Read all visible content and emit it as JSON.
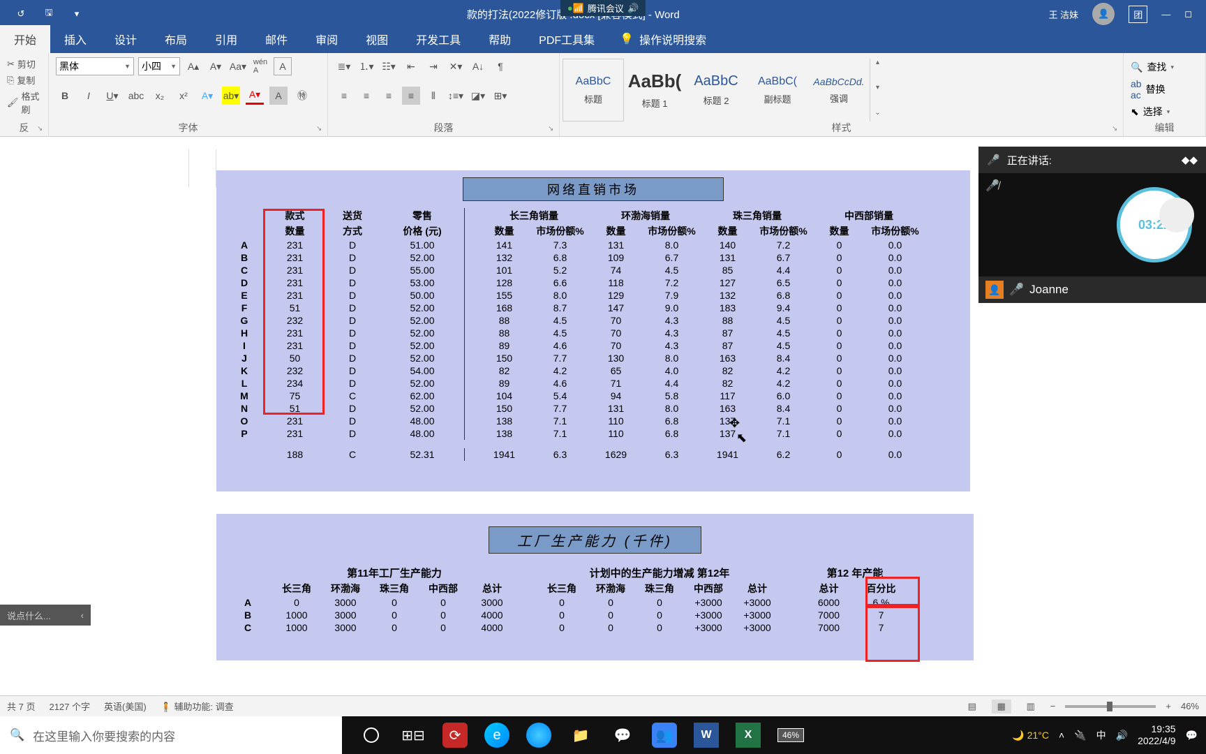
{
  "titlebar": {
    "meeting_badge": "腾讯会议",
    "doc_title": "款的打法(2022修订版 .docx [兼容模式] - Word",
    "user": "王 洁妹",
    "share_icon": "团"
  },
  "tabs": {
    "items": [
      "开始",
      "插入",
      "设计",
      "布局",
      "引用",
      "邮件",
      "审阅",
      "视图",
      "开发工具",
      "帮助",
      "PDF工具集"
    ],
    "tell_me": "操作说明搜索"
  },
  "ribbon": {
    "clipboard": {
      "cut": "剪切",
      "copy": "复制",
      "painter": "格式刷",
      "label": "反"
    },
    "font": {
      "name": "黑体",
      "size": "小四",
      "label": "字体"
    },
    "para": {
      "label": "段落"
    },
    "styles": {
      "items": [
        {
          "preview": "AaBbC",
          "name": "标题"
        },
        {
          "preview": "AaBb(",
          "name": "标题 1"
        },
        {
          "preview": "AaBbC",
          "name": "标题 2"
        },
        {
          "preview": "AaBbC(",
          "name": "副标题"
        },
        {
          "preview": "AaBbCcDd.",
          "name": "强调"
        }
      ],
      "label": "样式"
    },
    "editing": {
      "find": "查找",
      "replace": "替换",
      "select": "选择",
      "label": "编辑"
    }
  },
  "report1": {
    "title": "网络直销市场",
    "col_style1": "款式",
    "col_style2": "数量",
    "col_ship1": "送货",
    "col_ship2": "方式",
    "col_price1": "零售",
    "col_price2": "价格 (元)",
    "region1": "长三角销量",
    "region2": "环渤海销量",
    "region3": "珠三角销量",
    "region4": "中西部销量",
    "sub_qty": "数量",
    "sub_share": "市场份额%",
    "row_labels": [
      "A",
      "B",
      "C",
      "D",
      "E",
      "F",
      "G",
      "H",
      "I",
      "J",
      "K",
      "L",
      "M",
      "N",
      "O",
      "P"
    ],
    "rows": [
      [
        "231",
        "D",
        "51.00",
        "141",
        "7.3",
        "131",
        "8.0",
        "140",
        "7.2",
        "0",
        "0.0"
      ],
      [
        "231",
        "D",
        "52.00",
        "132",
        "6.8",
        "109",
        "6.7",
        "131",
        "6.7",
        "0",
        "0.0"
      ],
      [
        "231",
        "D",
        "55.00",
        "101",
        "5.2",
        "74",
        "4.5",
        "85",
        "4.4",
        "0",
        "0.0"
      ],
      [
        "231",
        "D",
        "53.00",
        "128",
        "6.6",
        "118",
        "7.2",
        "127",
        "6.5",
        "0",
        "0.0"
      ],
      [
        "231",
        "D",
        "50.00",
        "155",
        "8.0",
        "129",
        "7.9",
        "132",
        "6.8",
        "0",
        "0.0"
      ],
      [
        "51",
        "D",
        "52.00",
        "168",
        "8.7",
        "147",
        "9.0",
        "183",
        "9.4",
        "0",
        "0.0"
      ],
      [
        "232",
        "D",
        "52.00",
        "88",
        "4.5",
        "70",
        "4.3",
        "88",
        "4.5",
        "0",
        "0.0"
      ],
      [
        "231",
        "D",
        "52.00",
        "88",
        "4.5",
        "70",
        "4.3",
        "87",
        "4.5",
        "0",
        "0.0"
      ],
      [
        "231",
        "D",
        "52.00",
        "89",
        "4.6",
        "70",
        "4.3",
        "87",
        "4.5",
        "0",
        "0.0"
      ],
      [
        "50",
        "D",
        "52.00",
        "150",
        "7.7",
        "130",
        "8.0",
        "163",
        "8.4",
        "0",
        "0.0"
      ],
      [
        "232",
        "D",
        "54.00",
        "82",
        "4.2",
        "65",
        "4.0",
        "82",
        "4.2",
        "0",
        "0.0"
      ],
      [
        "234",
        "D",
        "52.00",
        "89",
        "4.6",
        "71",
        "4.4",
        "82",
        "4.2",
        "0",
        "0.0"
      ],
      [
        "75",
        "C",
        "62.00",
        "104",
        "5.4",
        "94",
        "5.8",
        "117",
        "6.0",
        "0",
        "0.0"
      ],
      [
        "51",
        "D",
        "52.00",
        "150",
        "7.7",
        "131",
        "8.0",
        "163",
        "8.4",
        "0",
        "0.0"
      ],
      [
        "231",
        "D",
        "48.00",
        "138",
        "7.1",
        "110",
        "6.8",
        "137",
        "7.1",
        "0",
        "0.0"
      ],
      [
        "231",
        "D",
        "48.00",
        "138",
        "7.1",
        "110",
        "6.8",
        "137",
        "7.1",
        "0",
        "0.0"
      ]
    ],
    "sum": [
      "188",
      "C",
      "52.31",
      "1941",
      "6.3",
      "1629",
      "6.3",
      "1941",
      "6.2",
      "0",
      "0.0"
    ]
  },
  "report2": {
    "title": "工厂生产能力 (千件)",
    "sec1": "第11年工厂生产能力",
    "sec2": "计划中的生产能力增减  第12年",
    "sec3": "第12 年产能",
    "cols1": [
      "长三角",
      "环渤海",
      "珠三角",
      "中西部",
      "总计"
    ],
    "cols2": [
      "长三角",
      "环渤海",
      "珠三角",
      "中西部",
      "总计"
    ],
    "cols3": [
      "总计",
      "百分比"
    ],
    "row_labels": [
      "A",
      "B",
      "C"
    ],
    "rows": [
      [
        "0",
        "3000",
        "0",
        "0",
        "3000",
        "0",
        "0",
        "0",
        "+3000",
        "+3000",
        "6000",
        "6 %"
      ],
      [
        "1000",
        "3000",
        "0",
        "0",
        "4000",
        "0",
        "0",
        "0",
        "+3000",
        "+3000",
        "7000",
        "7"
      ],
      [
        "1000",
        "3000",
        "0",
        "0",
        "4000",
        "0",
        "0",
        "0",
        "+3000",
        "+3000",
        "7000",
        "7"
      ]
    ]
  },
  "meeting": {
    "speaking_label": "正在讲话:",
    "timer": "03:22",
    "participant": "Joanne"
  },
  "comment_peek": "说点什么...",
  "statusbar": {
    "pages": "共 7 页",
    "words": "2127 个字",
    "lang": "英语(美国)",
    "a11y": "辅助功能: 调查",
    "zoom": "46%"
  },
  "taskbar": {
    "search_placeholder": "在这里输入你要搜索的内容",
    "battery": "46%",
    "weather": "21°C",
    "ime": "中",
    "time": "19:35",
    "date": "2022/4/9"
  }
}
